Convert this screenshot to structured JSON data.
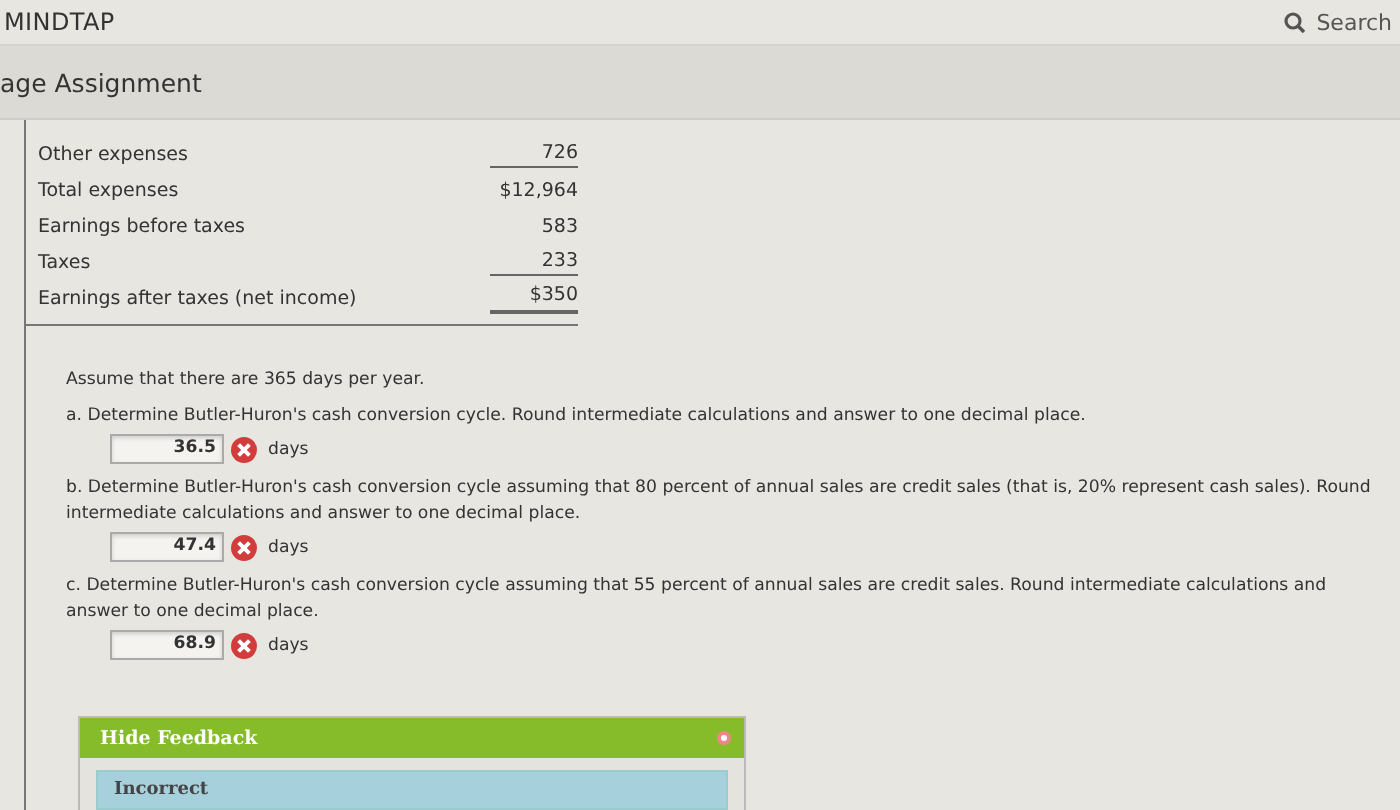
{
  "header": {
    "logo": "MINDTAP",
    "search_label": "Search"
  },
  "assignment_title": "age Assignment",
  "income_statement": [
    {
      "label": "Other expenses",
      "value": "726",
      "underlined": true,
      "double_underlined": false
    },
    {
      "label": "Total expenses",
      "value": "$12,964",
      "underlined": false,
      "double_underlined": false
    },
    {
      "label": "Earnings before taxes",
      "value": "583",
      "underlined": false,
      "double_underlined": false
    },
    {
      "label": "Taxes",
      "value": "233",
      "underlined": true,
      "double_underlined": false
    },
    {
      "label": "Earnings after taxes (net income)",
      "value": "$350",
      "underlined": true,
      "double_underlined": true
    }
  ],
  "intro": "Assume that there are 365 days per year.",
  "questions": [
    {
      "prompt": "a. Determine Butler-Huron's cash conversion cycle. Round intermediate calculations and answer to one decimal place.",
      "answer": "36.5",
      "unit": "days",
      "correct": false
    },
    {
      "prompt": "b. Determine Butler-Huron's cash conversion cycle assuming that 80 percent of annual sales are credit sales (that is, 20% represent cash sales). Round intermediate calculations and answer to one decimal place.",
      "answer": "47.4",
      "unit": "days",
      "correct": false
    },
    {
      "prompt": "c. Determine Butler-Huron's cash conversion cycle assuming that 55 percent of annual sales are credit sales. Round intermediate calculations and answer to one decimal place.",
      "answer": "68.9",
      "unit": "days",
      "correct": false
    }
  ],
  "feedback": {
    "toggle": "Hide Feedback",
    "message": "Incorrect"
  }
}
